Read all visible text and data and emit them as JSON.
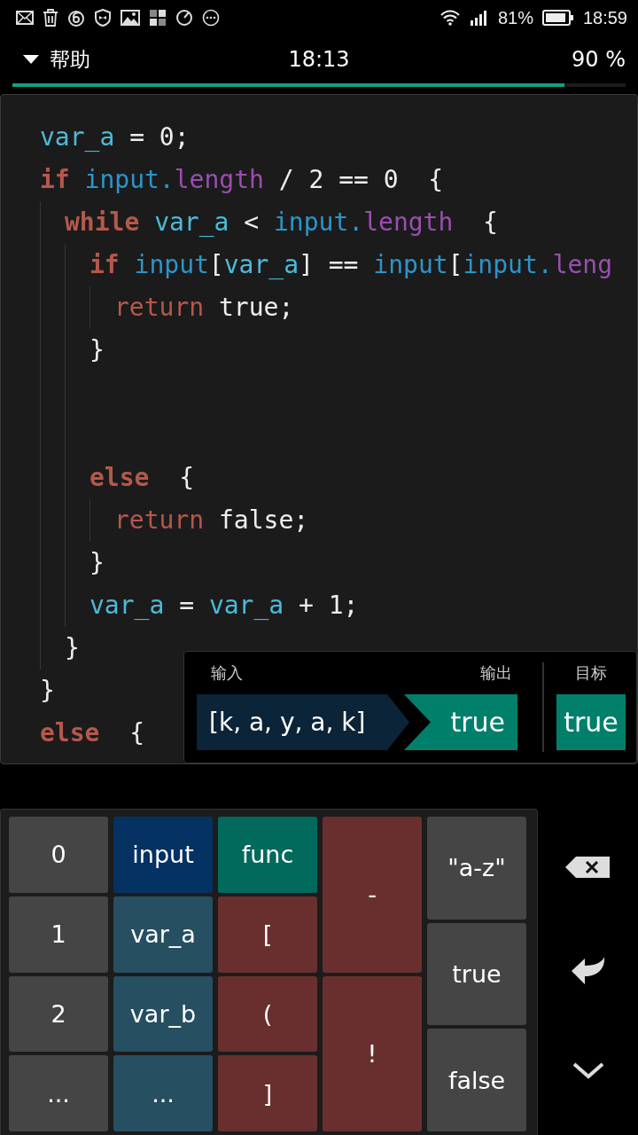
{
  "status_bar": {
    "battery_text": "81%",
    "time": "18:59"
  },
  "header": {
    "title": "帮助",
    "time": "18:13",
    "percent": "90 %",
    "progress": {
      "level": 0.9
    }
  },
  "code": [
    {
      "kind": "line",
      "tokens": [
        {
          "kind": "variable",
          "text": "var_a"
        },
        {
          "kind": "plain",
          "text": " = 0;"
        }
      ]
    },
    {
      "kind": "block",
      "close": "}",
      "tokens": [
        {
          "kind": "keyword",
          "text": "if"
        },
        {
          "kind": "input",
          "text": "input."
        },
        {
          "kind": "property",
          "text": "length"
        },
        {
          "kind": "plain",
          "text": " / 2 == 0  {"
        }
      ],
      "children": [
        {
          "kind": "block",
          "close": "}",
          "tokens": [
            {
              "kind": "keyword",
              "text": "while"
            },
            {
              "kind": "variable",
              "text": "var_a"
            },
            {
              "kind": "plain",
              "text": " < "
            },
            {
              "kind": "input",
              "text": "input."
            },
            {
              "kind": "property",
              "text": "length"
            },
            {
              "kind": "plain",
              "text": "  {"
            }
          ],
          "children": [
            {
              "kind": "block",
              "close": "}",
              "tokens": [
                {
                  "kind": "keyword",
                  "text": "if"
                },
                {
                  "kind": "input",
                  "text": "input"
                },
                {
                  "kind": "plain",
                  "text": "["
                },
                {
                  "kind": "variable",
                  "text": "var_a"
                },
                {
                  "kind": "plain",
                  "text": "] == "
                },
                {
                  "kind": "input",
                  "text": "input"
                },
                {
                  "kind": "plain",
                  "text": "["
                },
                {
                  "kind": "input",
                  "text": "input."
                },
                {
                  "kind": "property",
                  "text": "leng"
                }
              ],
              "children": [
                {
                  "kind": "line",
                  "tokens": [
                    {
                      "kind": "return",
                      "text": "return"
                    },
                    {
                      "kind": "plain",
                      "text": " true;"
                    }
                  ]
                }
              ]
            },
            {
              "kind": "blank"
            },
            {
              "kind": "blank"
            },
            {
              "kind": "block",
              "close": "}",
              "tokens": [
                {
                  "kind": "keyword",
                  "text": "else"
                },
                {
                  "kind": "plain",
                  "text": " {"
                }
              ],
              "children": [
                {
                  "kind": "line",
                  "tokens": [
                    {
                      "kind": "return",
                      "text": "return"
                    },
                    {
                      "kind": "plain",
                      "text": " false;"
                    }
                  ]
                }
              ]
            },
            {
              "kind": "line",
              "tokens": [
                {
                  "kind": "variable",
                  "text": "var_a"
                },
                {
                  "kind": "plain",
                  "text": " = "
                },
                {
                  "kind": "variable",
                  "text": "var_a"
                },
                {
                  "kind": "plain",
                  "text": " + 1;"
                }
              ]
            }
          ]
        }
      ]
    },
    {
      "kind": "open",
      "tokens": [
        {
          "kind": "keyword",
          "text": "else"
        },
        {
          "kind": "plain",
          "text": " {"
        }
      ]
    }
  ],
  "result": {
    "input_label": "输入",
    "output_label": "输出",
    "target_label": "目标",
    "input": "[k, a, y, a, k]",
    "output": "true",
    "target": "true"
  },
  "keypad": {
    "columns": [
      [
        {
          "kind": "number",
          "text": "0"
        },
        {
          "kind": "number",
          "text": "1"
        },
        {
          "kind": "number",
          "text": "2"
        },
        {
          "kind": "number",
          "text": "..."
        }
      ],
      [
        {
          "kind": "input",
          "text": "input"
        },
        {
          "kind": "variable",
          "text": "var_a"
        },
        {
          "kind": "variable",
          "text": "var_b"
        },
        {
          "kind": "variable",
          "text": "..."
        }
      ],
      [
        {
          "kind": "function",
          "text": "func"
        },
        {
          "kind": "symbol",
          "text": "["
        },
        {
          "kind": "symbol",
          "text": "("
        },
        {
          "kind": "symbol",
          "text": "]"
        }
      ],
      [
        {
          "kind": "symbol",
          "text": "-"
        },
        {
          "kind": "symbol",
          "text": "!"
        }
      ],
      [
        {
          "kind": "literal",
          "text": "\"a-z\""
        },
        {
          "kind": "literal",
          "text": "true"
        },
        {
          "kind": "literal",
          "text": "false"
        }
      ]
    ],
    "actions": [
      {
        "kind": "backspace"
      },
      {
        "kind": "enter"
      },
      {
        "kind": "collapse"
      }
    ]
  }
}
